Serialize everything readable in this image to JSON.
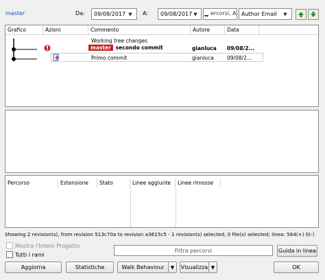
{
  "branch": "master",
  "filter": {
    "from_label": "Da:",
    "from_date": "09/08/2017",
    "to_label": "A:",
    "to_date": "09/08/2017",
    "search_placeholder": "ercorsi, Autor",
    "field_select": "Author Email"
  },
  "log": {
    "columns": [
      "Grafico",
      "Azioni",
      "Commento",
      "Autore",
      "Data"
    ],
    "rows": [
      {
        "comment": "Working tree changes",
        "author": "",
        "date": ""
      },
      {
        "tag": "master",
        "comment": "secondo commit",
        "author": "gianluca",
        "date": "09/08/2..."
      },
      {
        "comment": "Primo commit",
        "author": "gianluca",
        "date": "09/08/2..."
      }
    ]
  },
  "files": {
    "columns": [
      "Percorso",
      "Estensione",
      "Stato",
      "Linee aggiunte",
      "Linee rimosse"
    ]
  },
  "status_text": "Showing 2 revision(s), from revision 513c70a to revision a3615c5 - 1 revision(s) selected, 0 file(s) selected; linea: 564(+) 0(-)",
  "options": {
    "whole_project": "Mostra l'Intero Progetto",
    "all_branches": "Tutti i rami",
    "filter_paths_placeholder": "Filtra percorsi",
    "guide_button": "Guida in linea"
  },
  "buttons": {
    "refresh": "Aggiorna",
    "statistics": "Statistiche",
    "walk_behaviour": "Walk Behaviour",
    "view": "Visualizza",
    "ok": "OK"
  },
  "colors": {
    "tag_bg": "#c0221f",
    "link": "#1a4fb5",
    "nav_arrow": "#2e8b2e"
  }
}
